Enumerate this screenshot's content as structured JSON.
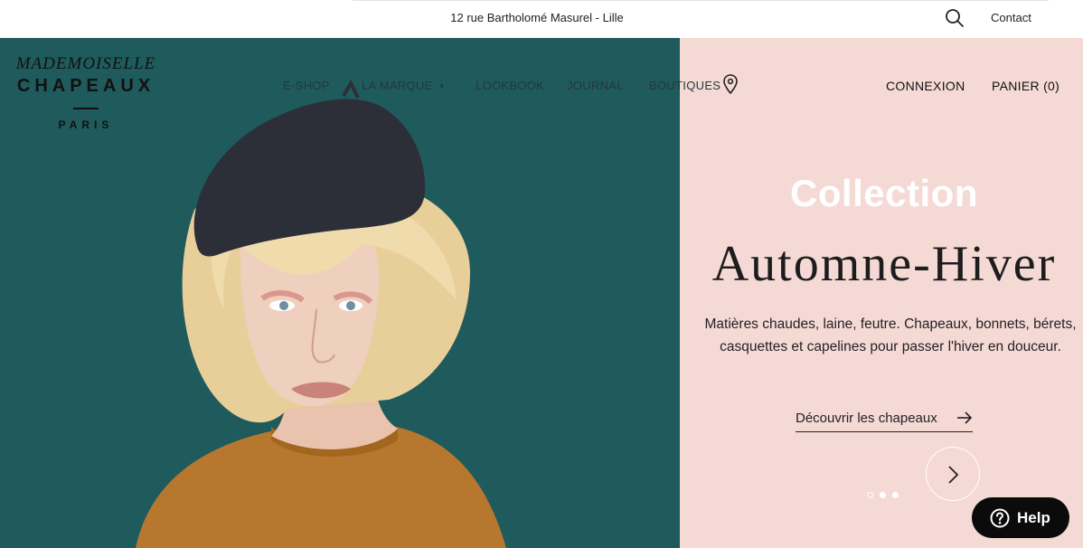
{
  "topbar": {
    "address": "12 rue Bartholomé Masurel - Lille",
    "contact_label": "Contact",
    "search_icon": "search-icon"
  },
  "logo": {
    "line1": "MADEMOISELLE",
    "line2": "CHAPEAUX",
    "line3": "PARIS"
  },
  "nav": {
    "eshop": "E-SHOP",
    "marque": "LA MARQUE",
    "lookbook": "LOOKBOOK",
    "journal": "JOURNAL",
    "boutiques": "BOUTIQUES",
    "connexion": "CONNEXION",
    "panier": "PANIER (0)"
  },
  "hero": {
    "collection": "Collection",
    "season": "Automne-Hiver",
    "description_line1": "Matières chaudes, laine, feutre. Chapeaux, bonnets, bérets,",
    "description_line2": "casquettes et capelines pour passer l'hiver en douceur.",
    "cta_label": "Découvrir les chapeaux",
    "slides_total": 3,
    "active_slide": 1
  },
  "help": {
    "label": "Help"
  },
  "colors": {
    "teal_background": "#1f5a5c",
    "pink_background": "#f5d9d5",
    "hat": "#2d2f38",
    "sweater": "#b8772e",
    "hair": "#e8cf9a",
    "help_button": "#0b0b0b"
  }
}
